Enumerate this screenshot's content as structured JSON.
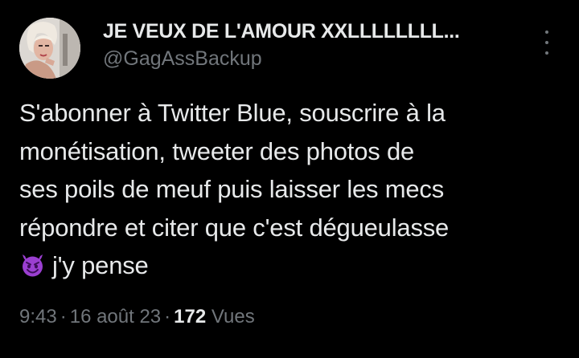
{
  "author": {
    "display_name": "JE VEUX DE L'AMOUR XXLLLLLLLL...",
    "handle": "@GagAssBackup",
    "avatar_icon": "profile-avatar"
  },
  "menu": {
    "icon": "more-vertical-icon"
  },
  "tweet": {
    "text_lines": [
      "S'abonner à Twitter Blue, souscrire à la",
      "monétisation, tweeter des photos de",
      "ses poils de meuf puis laisser les mecs",
      "répondre et citer que c'est dégueulasse"
    ],
    "emoji_icon": "smiling-devil-emoji",
    "last_line": "j'y pense"
  },
  "meta": {
    "time": "9:43",
    "date": "16 août 23",
    "separator": "·",
    "views_count": "172",
    "views_label": "Vues"
  },
  "colors": {
    "background": "#000000",
    "primary_text": "#e7e9ea",
    "secondary_text": "#71767b",
    "emoji_purple": "#9b3fd1"
  }
}
